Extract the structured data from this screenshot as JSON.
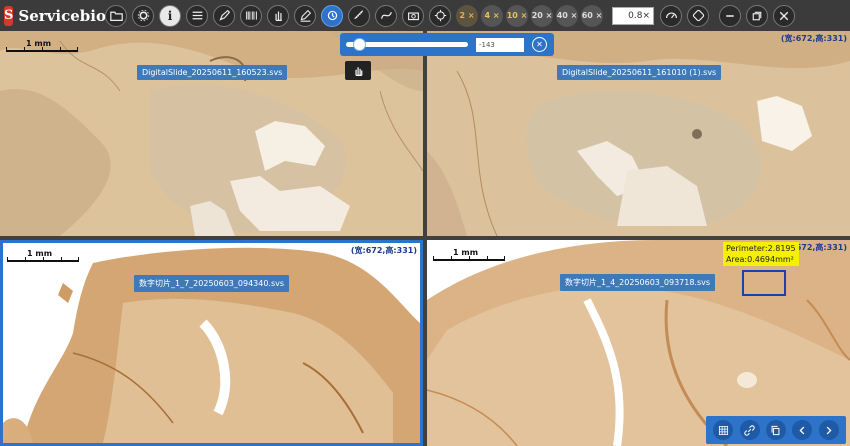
{
  "app": {
    "logo_mark": "S",
    "title": "Servicebio"
  },
  "toolbar": {
    "tools": [
      {
        "name": "open-folder",
        "icon": "folder-icon"
      },
      {
        "name": "settings",
        "icon": "gear-icon"
      },
      {
        "name": "info",
        "icon": "info-icon"
      },
      {
        "name": "list",
        "icon": "list-icon"
      },
      {
        "name": "annotate",
        "icon": "pencil-icon"
      },
      {
        "name": "barcode",
        "icon": "barcode-icon"
      },
      {
        "name": "hand",
        "icon": "hand-icon"
      },
      {
        "name": "draw",
        "icon": "pen-icon"
      },
      {
        "name": "rotate",
        "icon": "rotate-icon"
      },
      {
        "name": "ruler",
        "icon": "ruler-icon"
      },
      {
        "name": "curve",
        "icon": "curve-icon"
      },
      {
        "name": "camera",
        "icon": "camera-icon"
      },
      {
        "name": "fit",
        "icon": "crosshair-icon"
      }
    ],
    "magnifications": [
      "2 ×",
      "4 ×",
      "10 ×",
      "20 ×",
      "40 ×",
      "60 ×"
    ],
    "zoom_value": "0.8×"
  },
  "slider": {
    "value": "-143",
    "position": 0.06
  },
  "viewports": [
    {
      "label": "DigitalSlide_20250611_160523.svs",
      "coord": "",
      "scale": "1 mm"
    },
    {
      "label": "DigitalSlide_20250611_161010 (1).svs",
      "coord": "(宽:672,高:331)",
      "scale": ""
    },
    {
      "label": "数字切片_1_7_20250603_094340.svs",
      "coord": "(宽:672,高:331)",
      "scale": "1 mm"
    },
    {
      "label": "数字切片_1_4_20250603_093718.svs",
      "coord": "(宽:672,高:331)",
      "scale": "1 mm"
    }
  ],
  "measurement": {
    "perimeter": "Perimeter:2.8195",
    "area": "Area:0.4694mm²"
  },
  "bottom_nav": {
    "buttons": [
      "grid-icon",
      "link-icon",
      "copy-icon",
      "prev-icon",
      "next-icon"
    ]
  },
  "colors": {
    "accent": "#2d73c9",
    "tissue_brown": "#c8934f",
    "measure_yellow": "#f5f000"
  }
}
